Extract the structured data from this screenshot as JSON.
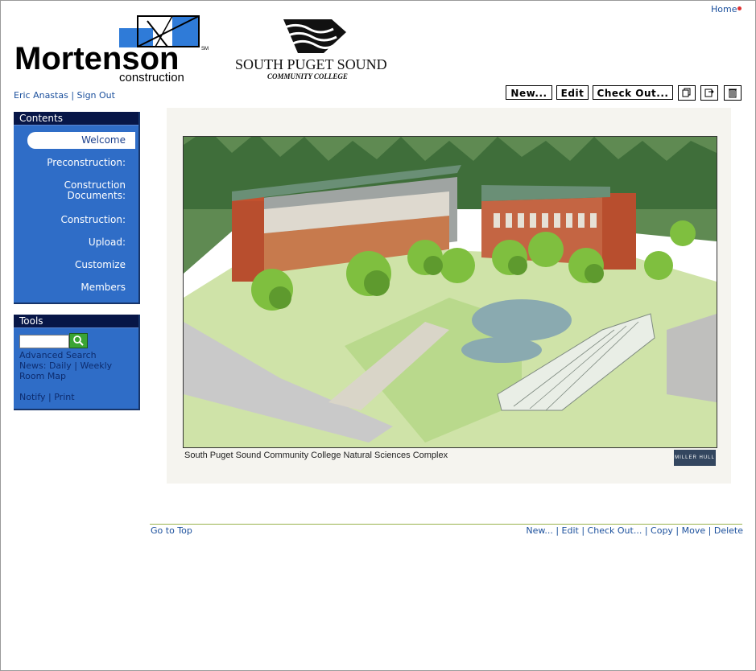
{
  "header": {
    "home_label": "Home",
    "user_name": "Eric Anastas",
    "sign_out_label": "Sign Out",
    "logos": {
      "mortenson_word": "Mortenson",
      "mortenson_sub": "construction",
      "mortenson_mark": "SM",
      "spscc_line1": "SOUTH PUGET SOUND",
      "spscc_line2": "COMMUNITY COLLEGE"
    }
  },
  "toolbar": {
    "new_label": "New...",
    "edit_label": "Edit",
    "checkout_label": "Check Out...",
    "icons": [
      "copy-icon",
      "move-icon",
      "delete-icon"
    ]
  },
  "sidebar": {
    "contents_title": "Contents",
    "items": [
      {
        "label": "Welcome",
        "active": true
      },
      {
        "label": "Preconstruction:"
      },
      {
        "label": "Construction Documents:"
      },
      {
        "label": "Construction:"
      },
      {
        "label": "Upload:"
      },
      {
        "label": "Customize"
      },
      {
        "label": "Members"
      }
    ],
    "tools_title": "Tools",
    "search": {
      "value": "",
      "button_icon": "magnifier-icon"
    },
    "advanced_search": "Advanced Search",
    "news_label": "News:",
    "news_daily": "Daily",
    "news_weekly": "Weekly",
    "room_map": "Room Map",
    "notify": "Notify",
    "print": "Print"
  },
  "main": {
    "image_caption": "South Puget Sound Community College Natural Sciences Complex",
    "image_badge": "MILLER HULL"
  },
  "footer": {
    "go_to_top": "Go to Top",
    "actions": [
      "New...",
      "Edit",
      "Check Out...",
      "Copy",
      "Move",
      "Delete"
    ]
  },
  "colors": {
    "nav_blue": "#2f6dc7",
    "nav_header": "#071647",
    "link": "#1a4f9c",
    "rule": "#99b34d",
    "home_dot": "#e03030"
  }
}
